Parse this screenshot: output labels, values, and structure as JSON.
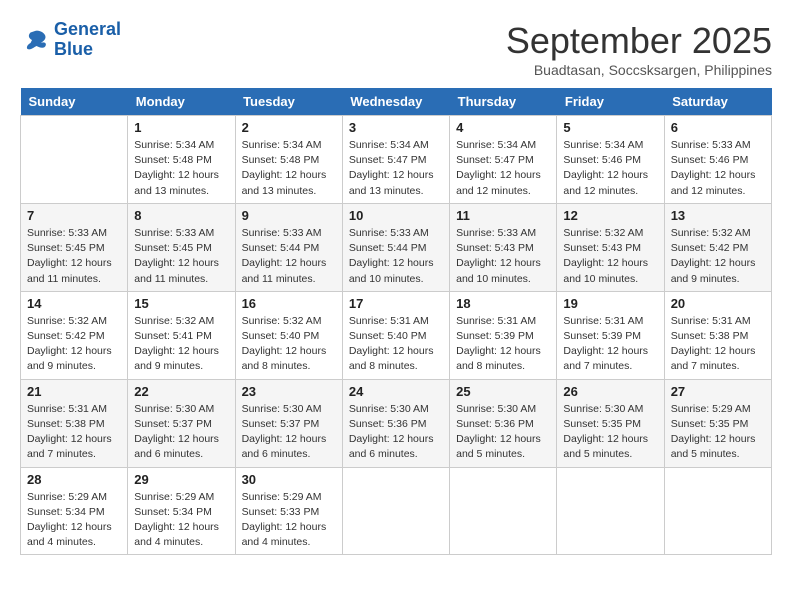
{
  "logo": {
    "line1": "General",
    "line2": "Blue"
  },
  "title": "September 2025",
  "subtitle": "Buadtasan, Soccsksargen, Philippines",
  "weekdays": [
    "Sunday",
    "Monday",
    "Tuesday",
    "Wednesday",
    "Thursday",
    "Friday",
    "Saturday"
  ],
  "weeks": [
    [
      {
        "day": "",
        "info": ""
      },
      {
        "day": "1",
        "info": "Sunrise: 5:34 AM\nSunset: 5:48 PM\nDaylight: 12 hours\nand 13 minutes."
      },
      {
        "day": "2",
        "info": "Sunrise: 5:34 AM\nSunset: 5:48 PM\nDaylight: 12 hours\nand 13 minutes."
      },
      {
        "day": "3",
        "info": "Sunrise: 5:34 AM\nSunset: 5:47 PM\nDaylight: 12 hours\nand 13 minutes."
      },
      {
        "day": "4",
        "info": "Sunrise: 5:34 AM\nSunset: 5:47 PM\nDaylight: 12 hours\nand 12 minutes."
      },
      {
        "day": "5",
        "info": "Sunrise: 5:34 AM\nSunset: 5:46 PM\nDaylight: 12 hours\nand 12 minutes."
      },
      {
        "day": "6",
        "info": "Sunrise: 5:33 AM\nSunset: 5:46 PM\nDaylight: 12 hours\nand 12 minutes."
      }
    ],
    [
      {
        "day": "7",
        "info": "Sunrise: 5:33 AM\nSunset: 5:45 PM\nDaylight: 12 hours\nand 11 minutes."
      },
      {
        "day": "8",
        "info": "Sunrise: 5:33 AM\nSunset: 5:45 PM\nDaylight: 12 hours\nand 11 minutes."
      },
      {
        "day": "9",
        "info": "Sunrise: 5:33 AM\nSunset: 5:44 PM\nDaylight: 12 hours\nand 11 minutes."
      },
      {
        "day": "10",
        "info": "Sunrise: 5:33 AM\nSunset: 5:44 PM\nDaylight: 12 hours\nand 10 minutes."
      },
      {
        "day": "11",
        "info": "Sunrise: 5:33 AM\nSunset: 5:43 PM\nDaylight: 12 hours\nand 10 minutes."
      },
      {
        "day": "12",
        "info": "Sunrise: 5:32 AM\nSunset: 5:43 PM\nDaylight: 12 hours\nand 10 minutes."
      },
      {
        "day": "13",
        "info": "Sunrise: 5:32 AM\nSunset: 5:42 PM\nDaylight: 12 hours\nand 9 minutes."
      }
    ],
    [
      {
        "day": "14",
        "info": "Sunrise: 5:32 AM\nSunset: 5:42 PM\nDaylight: 12 hours\nand 9 minutes."
      },
      {
        "day": "15",
        "info": "Sunrise: 5:32 AM\nSunset: 5:41 PM\nDaylight: 12 hours\nand 9 minutes."
      },
      {
        "day": "16",
        "info": "Sunrise: 5:32 AM\nSunset: 5:40 PM\nDaylight: 12 hours\nand 8 minutes."
      },
      {
        "day": "17",
        "info": "Sunrise: 5:31 AM\nSunset: 5:40 PM\nDaylight: 12 hours\nand 8 minutes."
      },
      {
        "day": "18",
        "info": "Sunrise: 5:31 AM\nSunset: 5:39 PM\nDaylight: 12 hours\nand 8 minutes."
      },
      {
        "day": "19",
        "info": "Sunrise: 5:31 AM\nSunset: 5:39 PM\nDaylight: 12 hours\nand 7 minutes."
      },
      {
        "day": "20",
        "info": "Sunrise: 5:31 AM\nSunset: 5:38 PM\nDaylight: 12 hours\nand 7 minutes."
      }
    ],
    [
      {
        "day": "21",
        "info": "Sunrise: 5:31 AM\nSunset: 5:38 PM\nDaylight: 12 hours\nand 7 minutes."
      },
      {
        "day": "22",
        "info": "Sunrise: 5:30 AM\nSunset: 5:37 PM\nDaylight: 12 hours\nand 6 minutes."
      },
      {
        "day": "23",
        "info": "Sunrise: 5:30 AM\nSunset: 5:37 PM\nDaylight: 12 hours\nand 6 minutes."
      },
      {
        "day": "24",
        "info": "Sunrise: 5:30 AM\nSunset: 5:36 PM\nDaylight: 12 hours\nand 6 minutes."
      },
      {
        "day": "25",
        "info": "Sunrise: 5:30 AM\nSunset: 5:36 PM\nDaylight: 12 hours\nand 5 minutes."
      },
      {
        "day": "26",
        "info": "Sunrise: 5:30 AM\nSunset: 5:35 PM\nDaylight: 12 hours\nand 5 minutes."
      },
      {
        "day": "27",
        "info": "Sunrise: 5:29 AM\nSunset: 5:35 PM\nDaylight: 12 hours\nand 5 minutes."
      }
    ],
    [
      {
        "day": "28",
        "info": "Sunrise: 5:29 AM\nSunset: 5:34 PM\nDaylight: 12 hours\nand 4 minutes."
      },
      {
        "day": "29",
        "info": "Sunrise: 5:29 AM\nSunset: 5:34 PM\nDaylight: 12 hours\nand 4 minutes."
      },
      {
        "day": "30",
        "info": "Sunrise: 5:29 AM\nSunset: 5:33 PM\nDaylight: 12 hours\nand 4 minutes."
      },
      {
        "day": "",
        "info": ""
      },
      {
        "day": "",
        "info": ""
      },
      {
        "day": "",
        "info": ""
      },
      {
        "day": "",
        "info": ""
      }
    ]
  ]
}
